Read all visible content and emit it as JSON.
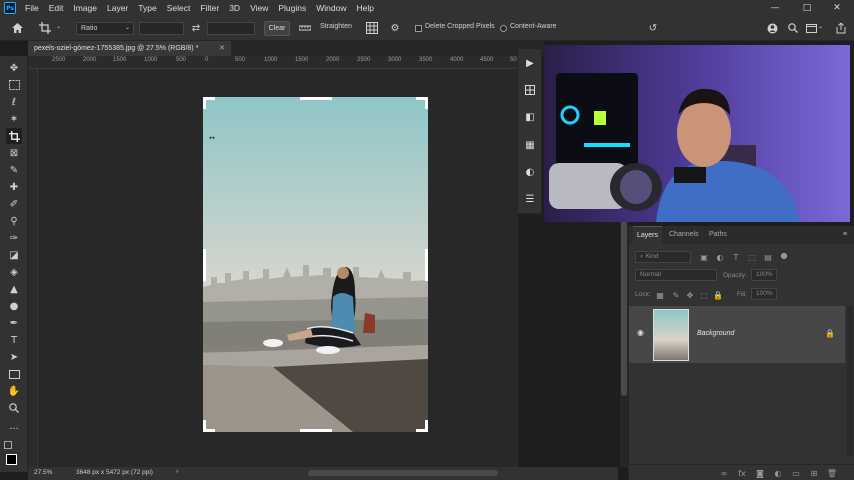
{
  "app": {
    "logo": "Ps"
  },
  "menu": [
    "File",
    "Edit",
    "Image",
    "Layer",
    "Type",
    "Select",
    "Filter",
    "3D",
    "View",
    "Plugins",
    "Window",
    "Help"
  ],
  "window_controls": {
    "minimize": "—",
    "maximize": "□",
    "close": "✕"
  },
  "options": {
    "ratio_label": "Ratio",
    "clear_label": "Clear",
    "straighten_label": "Straighten",
    "delete_cropped_label": "Delete Cropped Pixels",
    "content_aware_label": "Content-Aware"
  },
  "document": {
    "tab_title": "pexels-oziel-gómez-1755385.jpg @ 27.5% (RGB/8) *",
    "close_glyph": "✕"
  },
  "ruler_labels": [
    "2500",
    "2000",
    "1500",
    "1000",
    "500",
    "0",
    "500",
    "1000",
    "1500",
    "2000",
    "2500",
    "3000",
    "3500",
    "4000",
    "4500",
    "50"
  ],
  "status": {
    "zoom": "27.5%",
    "dimensions": "3648 px x 5472 px (72 ppi)",
    "arrow": "›"
  },
  "layers_panel": {
    "tabs": [
      "Layers",
      "Channels",
      "Paths"
    ],
    "kind_placeholder": "Kind",
    "blend_mode": "Normal",
    "opacity_label": "Opacity:",
    "opacity_value": "100%",
    "lock_label": "Lock:",
    "fill_label": "Fill:",
    "fill_value": "100%",
    "layer_name": "Background"
  },
  "colors": {
    "accent": "#31a8ff",
    "panel": "#323232",
    "canvas": "#282828"
  }
}
